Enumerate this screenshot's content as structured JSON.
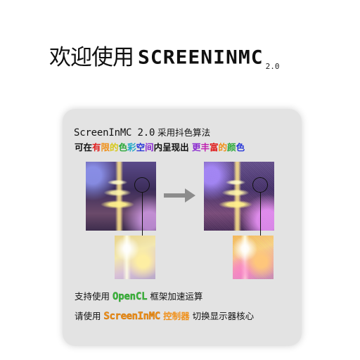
{
  "header": {
    "welcome": "欢迎使用",
    "brand": "SCREENINMC",
    "version": "2.0"
  },
  "card": {
    "line1": {
      "product": "ScreenInMC 2.0",
      "rest": " 采用抖色算法"
    },
    "line2": {
      "segments": [
        {
          "text": "可在",
          "color": "#111111"
        },
        {
          "text": "有",
          "color": "#e02020"
        },
        {
          "text": "限",
          "color": "#f0901a"
        },
        {
          "text": "的",
          "color": "#d8c818"
        },
        {
          "text": "色",
          "color": "#2ca83a"
        },
        {
          "text": "彩",
          "color": "#20a8c8"
        },
        {
          "text": "空",
          "color": "#2838d8"
        },
        {
          "text": "间",
          "color": "#8a2ad0"
        },
        {
          "text": "内呈现出 ",
          "color": "#111111"
        },
        {
          "text": "更",
          "color": "#8a2ad0"
        },
        {
          "text": "丰",
          "color": "#c020b0"
        },
        {
          "text": "富",
          "color": "#e02020"
        },
        {
          "text": "的",
          "color": "#f0901a"
        },
        {
          "text": "颜",
          "color": "#2ca83a"
        },
        {
          "text": "色",
          "color": "#2838d8"
        }
      ]
    },
    "line3": {
      "prefix": "支持使用 ",
      "highlight": "OpenCL",
      "suffix": " 框架加速运算"
    },
    "line4": {
      "prefix": "请使用 ",
      "highlight": "ScreenInMC",
      "highlight_cn": " 控制器",
      "suffix": " 切换显示器核心"
    }
  },
  "colors": {
    "card_background": "#e3e3e3",
    "opencl_green": "#3cb83c",
    "controller_orange": "#f0901a",
    "arrow_gray": "#8c8c8c"
  },
  "icons": {
    "arrow": "right-arrow-icon"
  }
}
